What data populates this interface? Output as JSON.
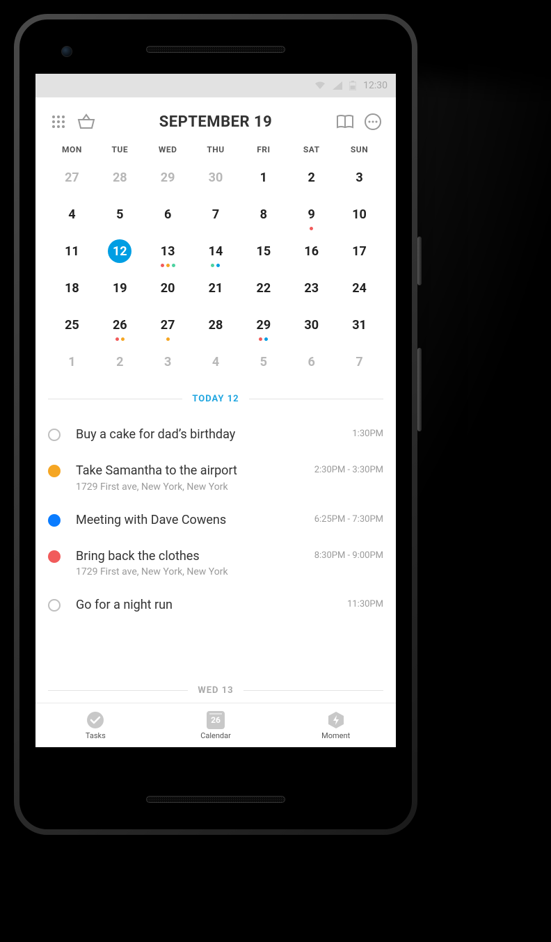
{
  "status": {
    "time": "12:30"
  },
  "header": {
    "title": "SEPTEMBER 19"
  },
  "weekdays": [
    "MON",
    "TUE",
    "WED",
    "THU",
    "FRI",
    "SAT",
    "SUN"
  ],
  "colors": {
    "accent": "#009ee3",
    "orange": "#f5a623",
    "red": "#f15b5b",
    "green": "#4cd2a0",
    "blue": "#0a7cff"
  },
  "calendar": {
    "rows": [
      [
        {
          "n": "27",
          "out": true
        },
        {
          "n": "28",
          "out": true
        },
        {
          "n": "29",
          "out": true
        },
        {
          "n": "30",
          "out": true
        },
        {
          "n": "1"
        },
        {
          "n": "2"
        },
        {
          "n": "3"
        }
      ],
      [
        {
          "n": "4"
        },
        {
          "n": "5"
        },
        {
          "n": "6"
        },
        {
          "n": "7"
        },
        {
          "n": "8"
        },
        {
          "n": "9",
          "dots": [
            "red"
          ]
        },
        {
          "n": "10"
        }
      ],
      [
        {
          "n": "11"
        },
        {
          "n": "12",
          "selected": true
        },
        {
          "n": "13",
          "dots": [
            "red",
            "orange",
            "green"
          ]
        },
        {
          "n": "14",
          "dots": [
            "green",
            "accent"
          ]
        },
        {
          "n": "15"
        },
        {
          "n": "16"
        },
        {
          "n": "17"
        }
      ],
      [
        {
          "n": "18"
        },
        {
          "n": "19"
        },
        {
          "n": "20"
        },
        {
          "n": "21"
        },
        {
          "n": "22"
        },
        {
          "n": "23"
        },
        {
          "n": "24"
        }
      ],
      [
        {
          "n": "25"
        },
        {
          "n": "26",
          "dots": [
            "red",
            "orange"
          ]
        },
        {
          "n": "27",
          "dots": [
            "orange"
          ]
        },
        {
          "n": "28"
        },
        {
          "n": "29",
          "dots": [
            "red",
            "accent"
          ]
        },
        {
          "n": "30"
        },
        {
          "n": "31"
        }
      ],
      [
        {
          "n": "1",
          "out": true
        },
        {
          "n": "2",
          "out": true
        },
        {
          "n": "3",
          "out": true
        },
        {
          "n": "4",
          "out": true
        },
        {
          "n": "5",
          "out": true
        },
        {
          "n": "6",
          "out": true
        },
        {
          "n": "7",
          "out": true
        }
      ]
    ]
  },
  "sections": {
    "today": "TODAY 12",
    "next": "WED 13"
  },
  "tasks": [
    {
      "type": "ring",
      "title": "Buy a cake for dad’s birthday",
      "time": "1:30PM"
    },
    {
      "type": "dot",
      "color": "orange",
      "title": "Take Samantha to the airport",
      "subtitle": "1729 First ave, New York, New York",
      "time": "2:30PM - 3:30PM"
    },
    {
      "type": "dot",
      "color": "blue",
      "title": "Meeting with Dave Cowens",
      "time": "6:25PM - 7:30PM"
    },
    {
      "type": "dot",
      "color": "red",
      "title": "Bring back the clothes",
      "subtitle": "1729 First ave, New York, New York",
      "time": "8:30PM - 9:00PM"
    },
    {
      "type": "ring",
      "title": "Go for a night run",
      "time": "11:30PM"
    }
  ],
  "nav": {
    "tasks": "Tasks",
    "calendar": "Calendar",
    "calendar_badge": "26",
    "moment": "Moment"
  }
}
